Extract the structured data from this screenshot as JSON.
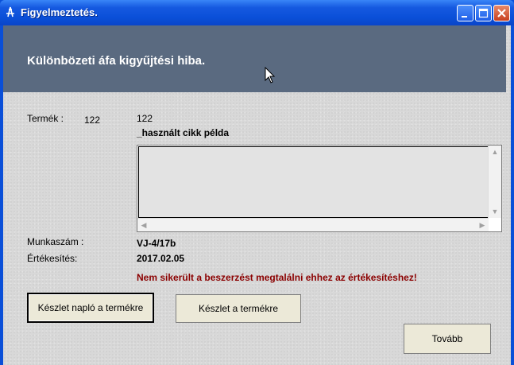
{
  "window": {
    "title": "Figyelmeztetés."
  },
  "header": {
    "title": "Különbözeti áfa kigyűjtési hiba."
  },
  "product": {
    "label": "Termék :",
    "code_left": "122",
    "code": "122",
    "name": "_használt cikk példa"
  },
  "memo": {
    "text": ""
  },
  "work_number": {
    "label": "Munkaszám :",
    "value": "VJ-4/17b"
  },
  "sale": {
    "label": "Értékesítés:",
    "value": "2017.02.05"
  },
  "error": {
    "message": "Nem sikerült a beszerzést megtalálni ehhez az értékesítéshez!"
  },
  "buttons": {
    "stock_log": "Készlet napló a termékre",
    "stock": "Készlet a termékre",
    "next": "Tovább"
  },
  "colors": {
    "titlebar": "#0a4fd8",
    "header": "#5a6a80",
    "error": "#8b0000"
  },
  "icons": {
    "app": "app-icon",
    "minimize": "minimize-icon",
    "maximize": "maximize-icon",
    "close": "close-icon"
  }
}
